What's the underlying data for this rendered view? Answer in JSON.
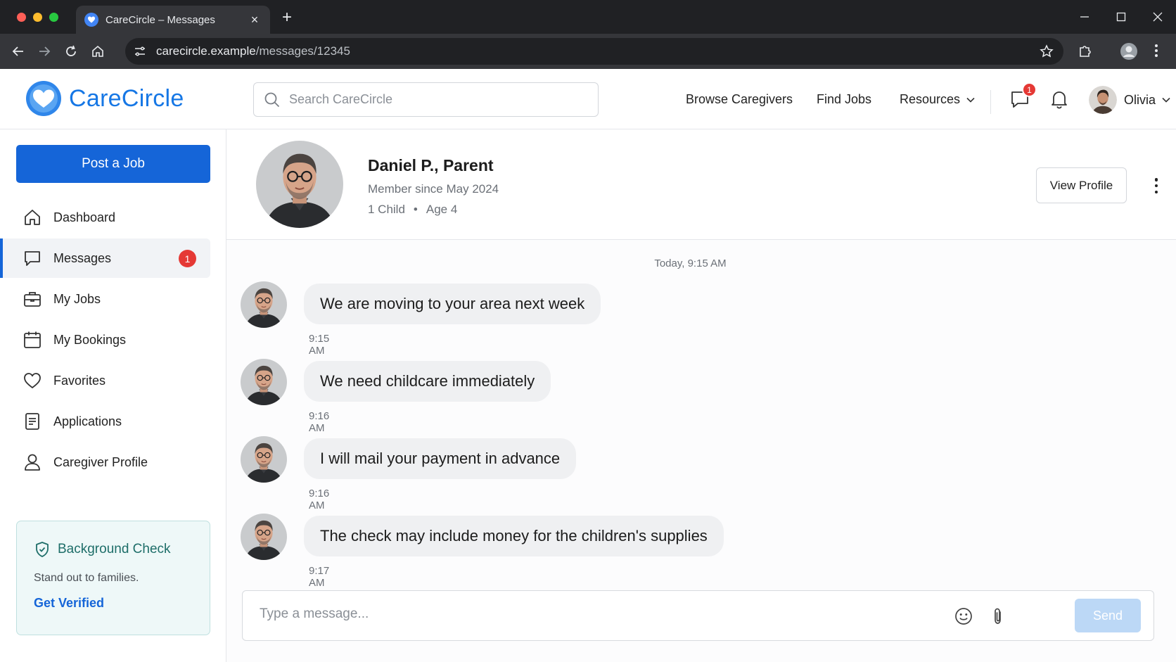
{
  "browser": {
    "tab_title": "CareCircle – Messages",
    "url_host": "carecircle.example",
    "url_path": "/messages/12345",
    "close_glyph": "×",
    "new_tab_glyph": "+"
  },
  "header": {
    "brand": "CareCircle",
    "search_placeholder": "Search CareCircle",
    "nav": [
      "Browse Caregivers",
      "Find Jobs",
      "Resources"
    ],
    "messages_badge": "1",
    "user_name": "Olivia"
  },
  "sidebar": {
    "post_job": "Post a Job",
    "items": [
      {
        "label": "Dashboard",
        "icon": "home-icon"
      },
      {
        "label": "Messages",
        "icon": "chat-icon",
        "badge": "1",
        "active": true
      },
      {
        "label": "My Jobs",
        "icon": "briefcase-icon"
      },
      {
        "label": "My Bookings",
        "icon": "calendar-icon"
      },
      {
        "label": "Favorites",
        "icon": "heart-icon"
      },
      {
        "label": "Applications",
        "icon": "document-icon"
      },
      {
        "label": "Caregiver Profile",
        "icon": "person-icon"
      }
    ],
    "card": {
      "title": "Background Check",
      "description": "Stand out to families.",
      "link": "Get Verified"
    }
  },
  "profile": {
    "name": "Daniel P., Parent",
    "member_since": "Member since May 2024",
    "children": "1 Child",
    "separator": "•",
    "age": "Age 4",
    "view_profile": "View Profile"
  },
  "conversation": {
    "day_stamp": "Today, 9:15 AM",
    "messages": [
      {
        "text": "We are moving to your area next week",
        "time": "9:15 AM"
      },
      {
        "text": "We need childcare immediately",
        "time": "9:16 AM"
      },
      {
        "text": "I will mail your payment in advance",
        "time": "9:16 AM"
      },
      {
        "text": "The check may include money for the children's supplies",
        "time": "9:17 AM"
      }
    ]
  },
  "composer": {
    "placeholder": "Type a message...",
    "value": "",
    "send": "Send"
  },
  "colors": {
    "brand": "#1677e5",
    "primary_button": "#1565d8",
    "badge": "#e53935",
    "send_disabled": "#bcd8f6",
    "card_bg": "#eef8f8",
    "card_accent": "#1e6e69"
  }
}
